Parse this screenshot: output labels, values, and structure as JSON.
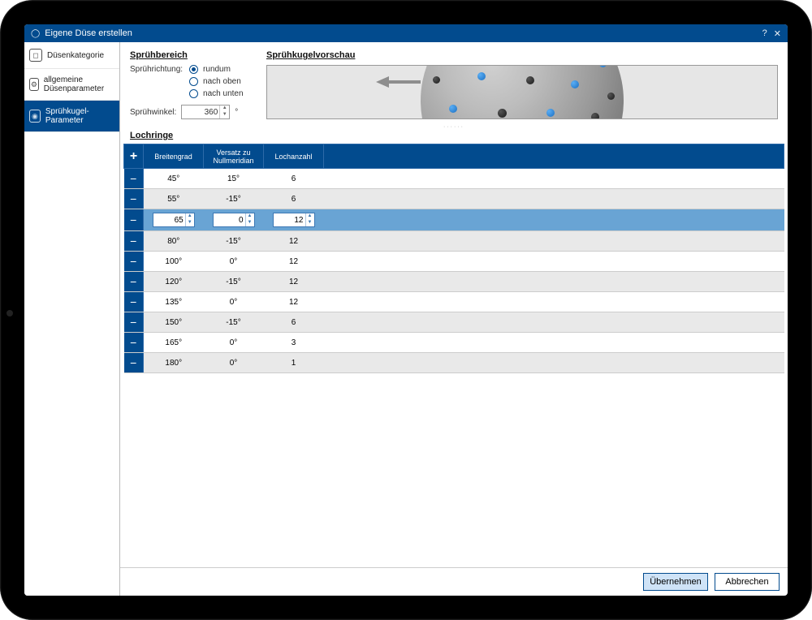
{
  "window": {
    "title": "Eigene Düse erstellen"
  },
  "sidebar": {
    "items": [
      {
        "label": "Düsenkategorie"
      },
      {
        "label": "allgemeine Düsenparameter"
      },
      {
        "label": "Sprühkugel-Parameter"
      }
    ]
  },
  "spray": {
    "section": "Sprühbereich",
    "direction_label": "Sprührichtung:",
    "options": {
      "allround": "rundum",
      "up": "nach oben",
      "down": "nach unten"
    },
    "angle_label": "Sprühwinkel:",
    "angle_value": "360",
    "deg": "°"
  },
  "preview": {
    "section": "Sprühkugelvorschau"
  },
  "rings": {
    "section": "Lochringe",
    "headers": {
      "add": "+",
      "lat": "Breitengrad",
      "off": "Versatz zu Nullmeridian",
      "cnt": "Lochanzahl"
    },
    "rows": [
      {
        "lat": "45°",
        "off": "15°",
        "cnt": "6",
        "selected": false
      },
      {
        "lat": "55°",
        "off": "-15°",
        "cnt": "6",
        "selected": false
      },
      {
        "lat": "65",
        "off": "0",
        "cnt": "12",
        "selected": true
      },
      {
        "lat": "80°",
        "off": "-15°",
        "cnt": "12",
        "selected": false
      },
      {
        "lat": "100°",
        "off": "0°",
        "cnt": "12",
        "selected": false
      },
      {
        "lat": "120°",
        "off": "-15°",
        "cnt": "12",
        "selected": false
      },
      {
        "lat": "135°",
        "off": "0°",
        "cnt": "12",
        "selected": false
      },
      {
        "lat": "150°",
        "off": "-15°",
        "cnt": "6",
        "selected": false
      },
      {
        "lat": "165°",
        "off": "0°",
        "cnt": "3",
        "selected": false
      },
      {
        "lat": "180°",
        "off": "0°",
        "cnt": "1",
        "selected": false
      }
    ]
  },
  "footer": {
    "apply": "Übernehmen",
    "cancel": "Abbrechen"
  }
}
